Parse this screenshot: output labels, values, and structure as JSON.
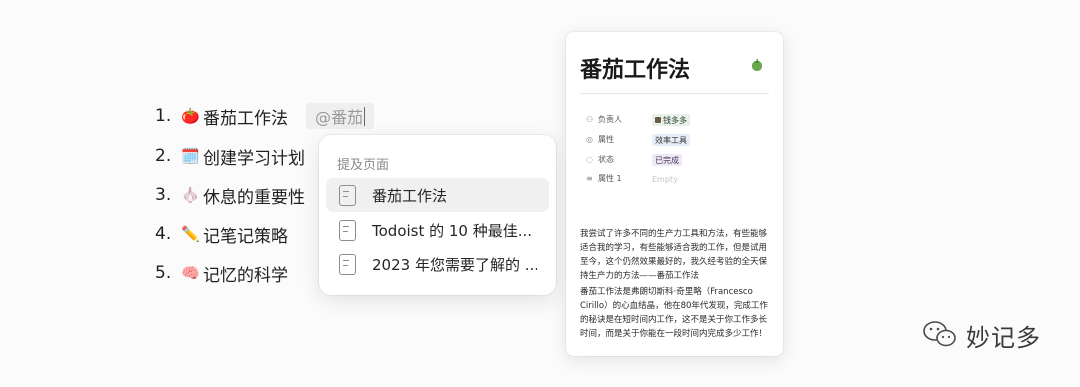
{
  "list": [
    {
      "num": "1.",
      "emoji": "🍅",
      "text": "番茄工作法"
    },
    {
      "num": "2.",
      "emoji": "🗓️",
      "text": "创建学习计划"
    },
    {
      "num": "3.",
      "emoji": "🧄",
      "text": "休息的重要性"
    },
    {
      "num": "4.",
      "emoji": "✏️",
      "text": "记笔记策略"
    },
    {
      "num": "5.",
      "emoji": "🧠",
      "text": "记忆的科学"
    }
  ],
  "mention": {
    "text": "@番茄"
  },
  "dropdown": {
    "heading": "提及页面",
    "items": [
      {
        "label": "番茄工作法"
      },
      {
        "label": "Todoist 的 10 种最佳..."
      },
      {
        "label": "2023 年您需要了解的 ..."
      }
    ]
  },
  "card": {
    "title": "番茄工作法",
    "edit_icon": "tomato-icon",
    "properties": [
      {
        "icon": "people-icon",
        "label": "负责人",
        "value": "钱多多"
      },
      {
        "icon": "check-circle-icon",
        "label": "属性",
        "value": "效率工具"
      },
      {
        "icon": "status-icon",
        "label": "状态",
        "value": "已完成"
      },
      {
        "icon": "text-icon",
        "label": "属性 1",
        "value": "Empty"
      }
    ],
    "paragraph1": "我尝试了许多不同的生产力工具和方法，有些能够适合我的学习，有些能够适合我的工作，但是试用至今，这个仍然效果最好的，我久经考验的全天保持生产力的方法——番茄工作法",
    "paragraph2": "番茄工作法是弗朗切斯科·奇里略（Francesco Cirillo）的心血结晶，他在80年代发现，完成工作的秘诀是在短时间内工作，这不是关于你工作多长时间，而是关于你能在一段时间内完成多少工作！"
  },
  "watermark": {
    "text": "妙记多"
  },
  "colors": {
    "active_item": "#f0f0f0",
    "tag_green": "#e7f1e8",
    "tag_blue": "#e6eef7",
    "tag_purple": "#efe9f5"
  }
}
